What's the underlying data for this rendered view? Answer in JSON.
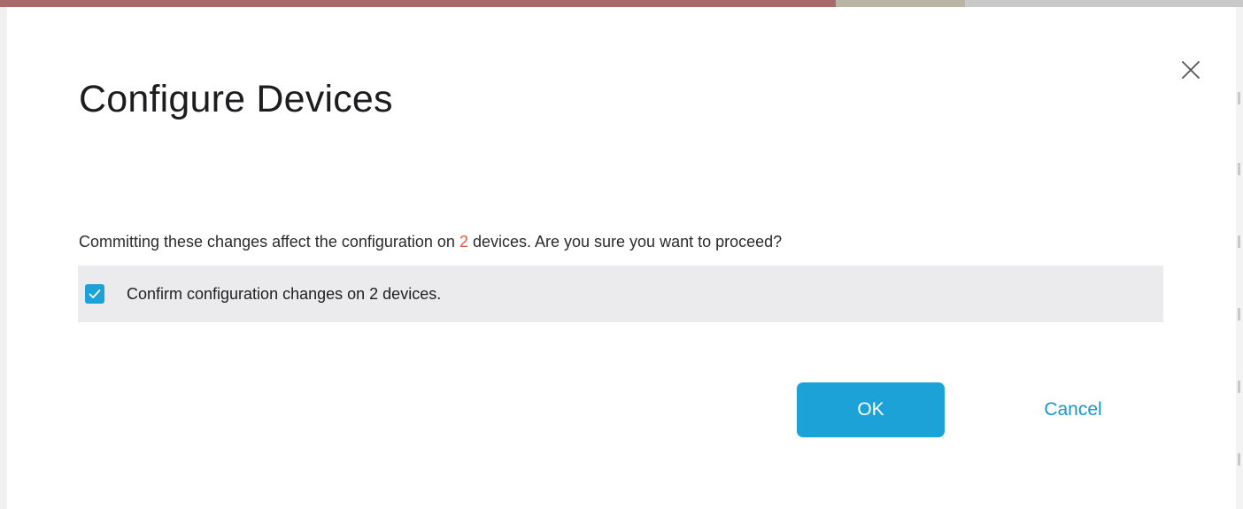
{
  "dialog": {
    "title": "Configure Devices",
    "close_icon": "close-icon",
    "message": {
      "before": "Committing these changes affect the configuration on ",
      "count": "2",
      "after": " devices. Are you sure you want to proceed?"
    },
    "confirm": {
      "checked": true,
      "label": "Confirm configuration changes on 2 devices.",
      "icon": "check-icon"
    },
    "buttons": {
      "ok": "OK",
      "cancel": "Cancel"
    }
  },
  "colors": {
    "accent": "#1da2d8",
    "count_highlight": "#e8553f",
    "cancel_text": "#1996cc",
    "confirm_row_bg": "#ebebee"
  }
}
